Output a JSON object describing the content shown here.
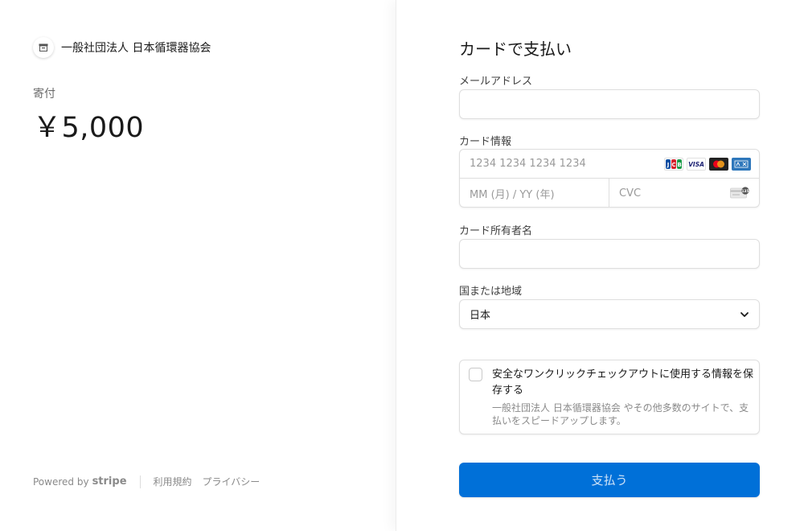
{
  "merchant": {
    "name": "一般社団法人 日本循環器協会",
    "logo_icon": "store-icon"
  },
  "summary": {
    "label": "寄付",
    "amount": "￥5,000"
  },
  "footer": {
    "powered_by": "Powered by",
    "brand": "stripe",
    "terms": "利用規約",
    "privacy": "プライバシー"
  },
  "form": {
    "title": "カードで支払い",
    "email": {
      "label": "メールアドレス",
      "value": ""
    },
    "card": {
      "label": "カード情報",
      "number_placeholder": "1234 1234 1234 1234",
      "expiry_placeholder": "MM (月) / YY (年)",
      "cvc_placeholder": "CVC",
      "cvc_icon": "card-cvc-icon",
      "brands": [
        "JCB",
        "VISA",
        "Mastercard",
        "AMEX"
      ]
    },
    "cardholder": {
      "label": "カード所有者名",
      "value": ""
    },
    "country": {
      "label": "国または地域",
      "selected": "日本",
      "icon": "chevron-down-icon"
    },
    "save": {
      "title": "安全なワンクリックチェックアウトに使用する情報を保存する",
      "description": "一般社団法人 日本循環器協会 やその他多数のサイトで、支払いをスピードアップします。"
    },
    "pay_button": "支払う"
  },
  "colors": {
    "accent": "#0070d8",
    "border": "#dedede",
    "muted_text": "#8a8a8a"
  }
}
